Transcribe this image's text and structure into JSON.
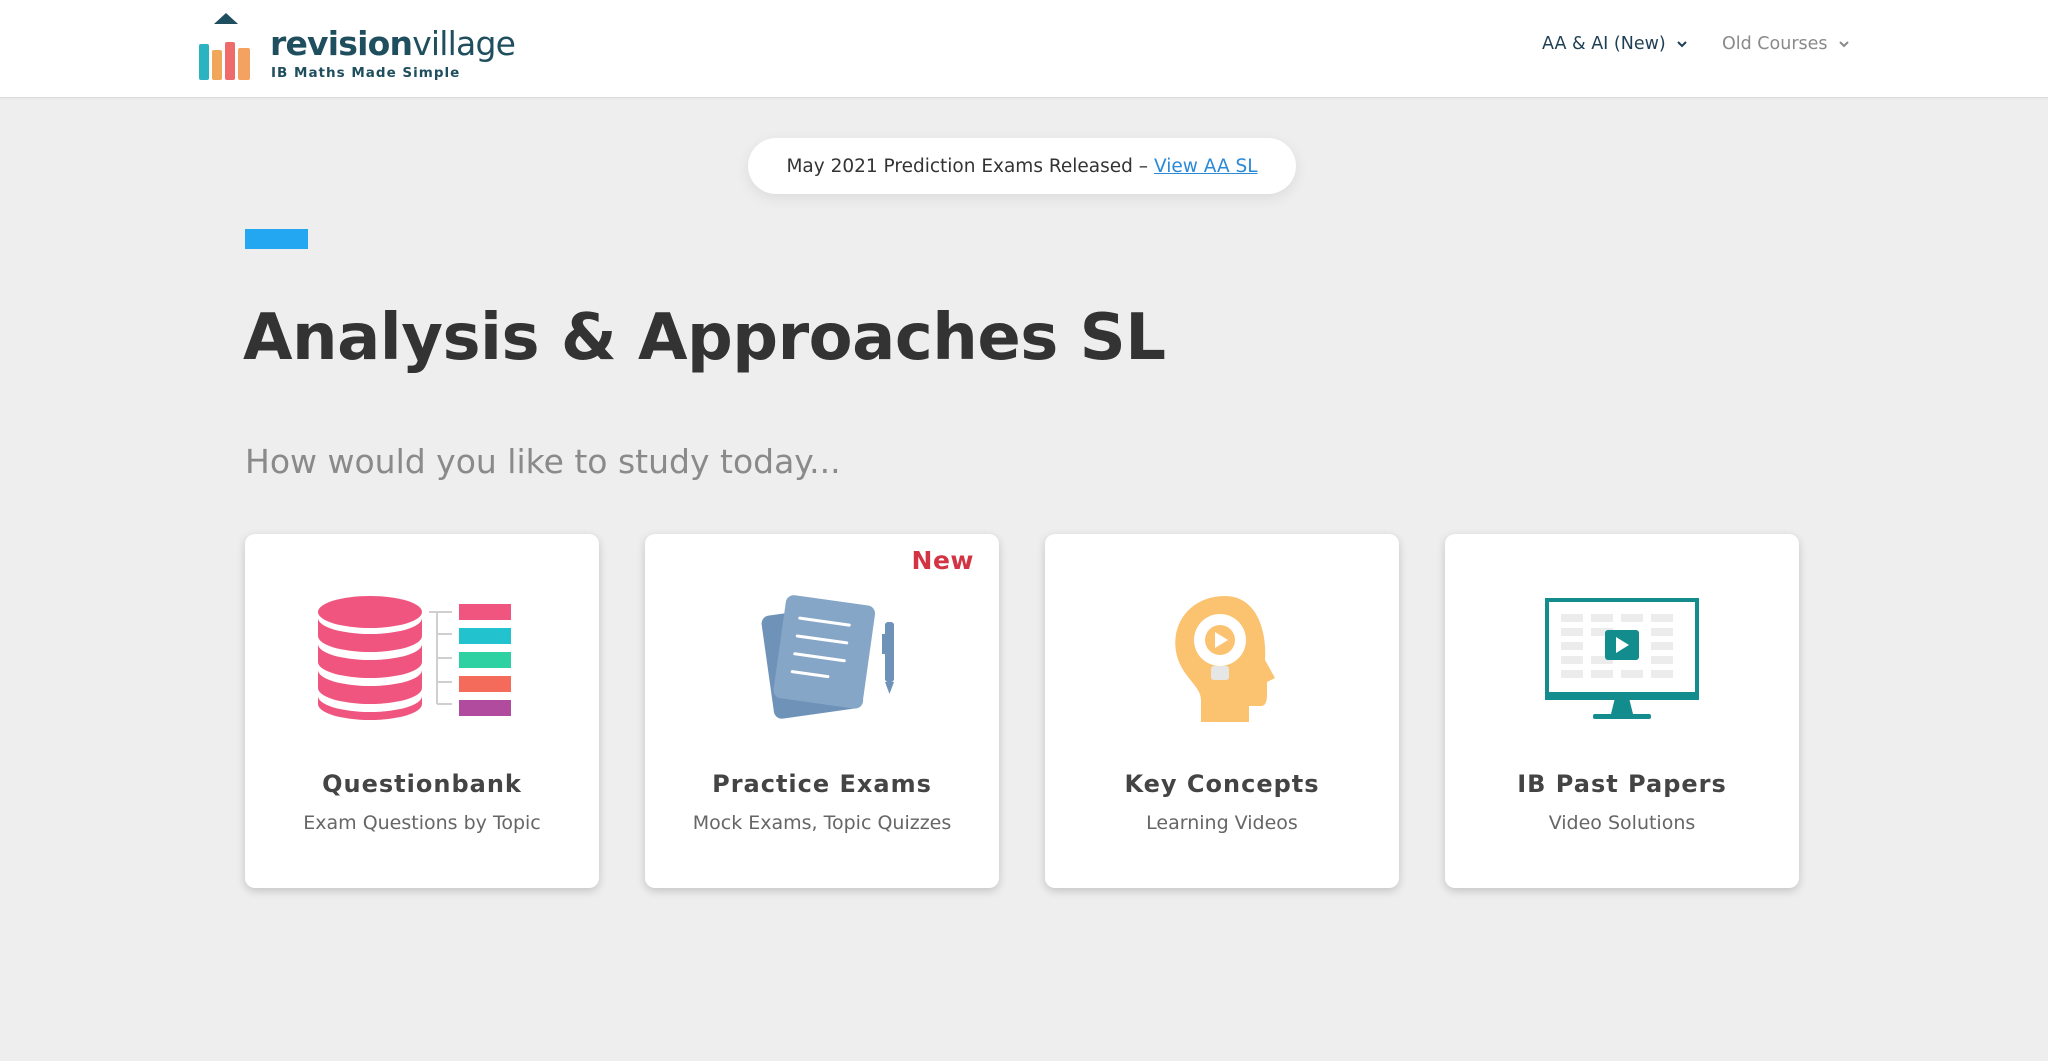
{
  "header": {
    "logo": {
      "word_bold": "revision",
      "word_light": "village",
      "tagline": "IB Maths Made Simple"
    },
    "nav": [
      {
        "label": "AA & AI (New)",
        "color": "#1f3f55"
      },
      {
        "label": "Old Courses",
        "color": "#8a8a8a"
      }
    ]
  },
  "announcement": {
    "text": "May 2021 Prediction Exams Released –",
    "link_label": "View AA SL"
  },
  "page": {
    "title": "Analysis & Approaches SL",
    "subtitle": "How would you like to study today..."
  },
  "cards": [
    {
      "title": "Questionbank",
      "subtitle": "Exam Questions by Topic",
      "icon": "database-list-icon"
    },
    {
      "title": "Practice Exams",
      "subtitle": "Mock Exams, Topic Quizzes",
      "icon": "exam-papers-icon",
      "badge": "New"
    },
    {
      "title": "Key Concepts",
      "subtitle": "Learning Videos",
      "icon": "head-lightbulb-icon"
    },
    {
      "title": "IB Past Papers",
      "subtitle": "Video Solutions",
      "icon": "monitor-video-icon"
    }
  ],
  "colors": {
    "accent_blue": "#22a7f0",
    "link_blue": "#2a8ad8",
    "new_badge_red": "#d23444",
    "brand_dark": "#1f4e5f"
  }
}
